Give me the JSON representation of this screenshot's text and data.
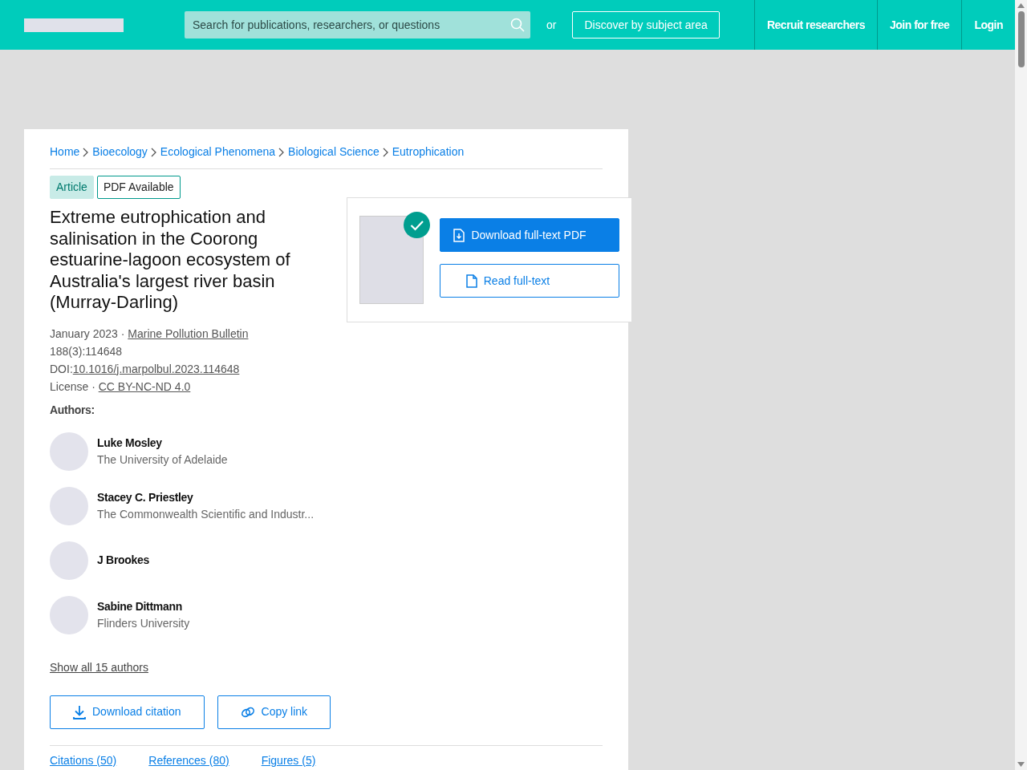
{
  "header": {
    "search": {
      "placeholder": "Search for publications, researchers, or questions"
    },
    "or_label": "or",
    "discover_button": "Discover by subject area",
    "nav": [
      "Recruit researchers",
      "Join for free",
      "Login"
    ]
  },
  "breadcrumbs": [
    "Home",
    "Bioecology",
    "Ecological Phenomena",
    "Biological Science",
    "Eutrophication"
  ],
  "badges": [
    {
      "label": "Article",
      "kind": "filled"
    },
    {
      "label": "PDF Available",
      "kind": "outline"
    }
  ],
  "title": "Extreme eutrophication and salinisation in the Coorong estuarine-lagoon ecosystem of Australia's largest river basin (Murray-Darling)",
  "meta": {
    "date": "January 2023 · ",
    "journal": "Marine Pollution Bulletin",
    "issue": "188(3):114648",
    "doi_label": "DOI:",
    "doi": "10.1016/j.marpolbul.2023.114648",
    "license_label": "License · ",
    "license": "CC BY-NC-ND 4.0"
  },
  "authors_label": "Authors:",
  "authors": [
    {
      "name": "Luke Mosley",
      "affiliation": "The University of Adelaide"
    },
    {
      "name": "Stacey C. Priestley",
      "affiliation": "The Commonwealth Scientific and Industr..."
    },
    {
      "name": "J Brookes"
    },
    {
      "name": "Sabine Dittmann",
      "affiliation": "Flinders University"
    }
  ],
  "show_all": "Show all 15 authors",
  "actions": [
    "Download citation",
    "Copy link"
  ],
  "fulltext": {
    "available": true,
    "download": "Download full-text PDF",
    "read": "Read full-text"
  },
  "tabs": [
    {
      "label": "Citations (50)",
      "selected": false
    },
    {
      "label": "References (80)",
      "selected": false
    },
    {
      "label": "Figures (5)",
      "selected": false
    }
  ]
}
